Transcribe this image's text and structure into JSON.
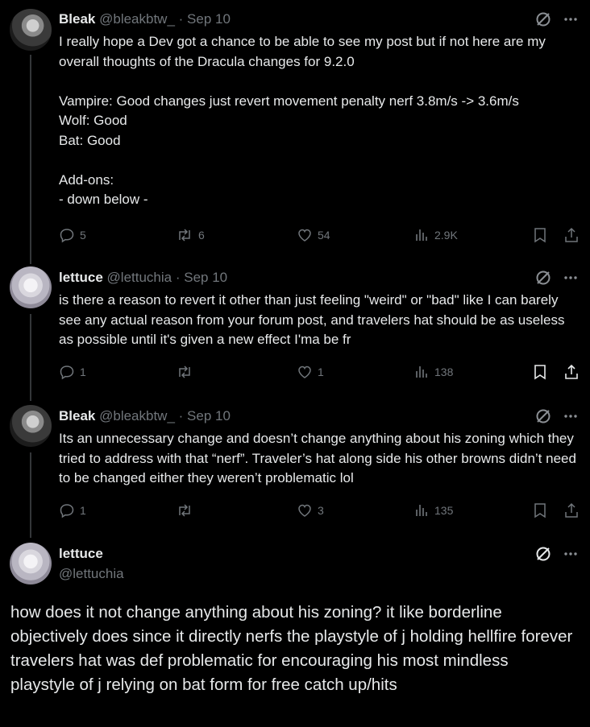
{
  "posts": [
    {
      "name": "Bleak",
      "handle": "@bleakbtw_",
      "date": "· Sep 10",
      "text": "I really hope a Dev got a chance to be able to see my post but if not here are my overall thoughts of the Dracula changes for 9.2.0\n\nVampire: Good changes just revert movement penalty nerf 3.8m/s -> 3.6m/s\nWolf: Good\nBat: Good\n\nAdd-ons:\n- down below -",
      "replies": "5",
      "reposts": "6",
      "likes": "54",
      "views": "2.9K"
    },
    {
      "name": "lettuce",
      "handle": "@lettuchia",
      "date": "· Sep 10",
      "text": "is there a reason to revert it other than just feeling \"weird\" or \"bad\" like I can barely see any actual reason from your forum post, and travelers hat should be as useless as possible until it's given a new effect I'ma be fr",
      "replies": "1",
      "reposts": "",
      "likes": "1",
      "views": "138"
    },
    {
      "name": "Bleak",
      "handle": "@bleakbtw_",
      "date": "· Sep 10",
      "text": "Its an unnecessary change and doesn’t change anything about his zoning which they tried to address with that “nerf”. Traveler’s hat along side his other browns didn’t need to be changed either they weren’t problematic lol",
      "replies": "1",
      "reposts": "",
      "likes": "3",
      "views": "135"
    }
  ],
  "main_post": {
    "name": "lettuce",
    "handle": "@lettuchia",
    "text": "how does it not change anything about his zoning? it like borderline objectively does since it directly nerfs the playstyle of j holding hellfire forever\ntravelers hat was def problematic for encouraging his most mindless playstyle of j relying on bat form for free catch up/hits"
  },
  "icons": {
    "reply": "reply-icon",
    "repost": "repost-icon",
    "like": "heart-icon",
    "views": "views-icon",
    "bookmark": "bookmark-icon",
    "share": "share-icon",
    "grok": "grok-icon",
    "more": "more-icon"
  },
  "colors": {
    "background": "#000000",
    "text": "#e7e9ea",
    "secondary": "#71767b",
    "thread_line": "#333639"
  }
}
